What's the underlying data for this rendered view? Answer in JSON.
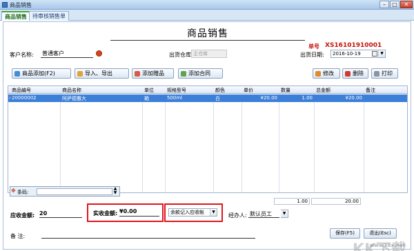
{
  "window": {
    "title": "商品销售",
    "btn_min": "–",
    "btn_max": "□",
    "btn_close": "✕"
  },
  "tabs": [
    {
      "label": "商品销售"
    },
    {
      "label": "待审核销售单"
    }
  ],
  "doc": {
    "title": "商品销售",
    "number_label": "单号",
    "number_value": "XS16101910001"
  },
  "header": {
    "customer_label": "客户名称:",
    "customer_value": "普通客户",
    "warehouse_label": "出货仓库:",
    "warehouse_value": "主仓库",
    "date_label": "出货日期:",
    "date_value": "2016-10-19"
  },
  "toolbar": {
    "add_goods": "商品添加(F2)",
    "import_export": "导入、导出",
    "add_gift": "添加赠品",
    "add_contract": "添加合同",
    "edit": "修改",
    "delete": "删除",
    "print": "打印"
  },
  "table": {
    "columns": [
      "商品编号",
      "商品名称",
      "单位",
      "规格型号",
      "颜色",
      "单价",
      "数量",
      "总金额",
      "备注"
    ],
    "rows": [
      {
        "code": "20000002",
        "name": "阿萨德撒大",
        "unit": "箱",
        "spec": "500ml",
        "color": "白",
        "price": "¥20.00",
        "qty": "1.00",
        "total": "¥20.00",
        "note": ""
      }
    ]
  },
  "barcode": {
    "label": "条码:"
  },
  "totals": {
    "qty": "1.00",
    "amount": "20.00"
  },
  "bottom": {
    "receivable_label": "应收金额:",
    "receivable_value": "20",
    "actual_label": "实收金额:",
    "actual_value": "¥0.00",
    "balance_option": "余款记入应收帐",
    "handler_label": "经办人:",
    "handler_value": "默认员工",
    "memo_label": "备    注:"
  },
  "actions": {
    "save": "保存(F5)",
    "exit": "退出(Esc)"
  },
  "watermark": {
    "text": "KK下载",
    "url": "www.kkx.net"
  }
}
